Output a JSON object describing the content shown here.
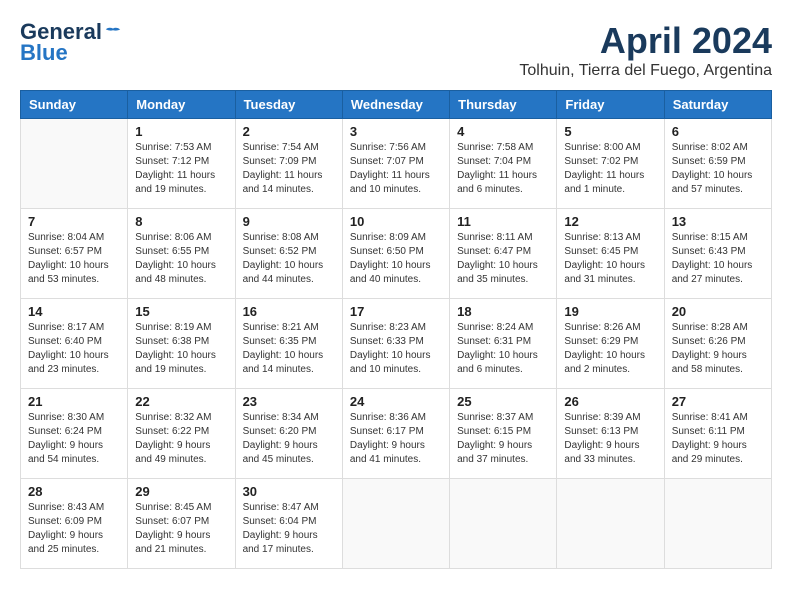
{
  "header": {
    "logo_line1": "General",
    "logo_line2": "Blue",
    "month": "April 2024",
    "location": "Tolhuin, Tierra del Fuego, Argentina"
  },
  "weekdays": [
    "Sunday",
    "Monday",
    "Tuesday",
    "Wednesday",
    "Thursday",
    "Friday",
    "Saturday"
  ],
  "weeks": [
    [
      {
        "day": "",
        "info": ""
      },
      {
        "day": "1",
        "info": "Sunrise: 7:53 AM\nSunset: 7:12 PM\nDaylight: 11 hours\nand 19 minutes."
      },
      {
        "day": "2",
        "info": "Sunrise: 7:54 AM\nSunset: 7:09 PM\nDaylight: 11 hours\nand 14 minutes."
      },
      {
        "day": "3",
        "info": "Sunrise: 7:56 AM\nSunset: 7:07 PM\nDaylight: 11 hours\nand 10 minutes."
      },
      {
        "day": "4",
        "info": "Sunrise: 7:58 AM\nSunset: 7:04 PM\nDaylight: 11 hours\nand 6 minutes."
      },
      {
        "day": "5",
        "info": "Sunrise: 8:00 AM\nSunset: 7:02 PM\nDaylight: 11 hours\nand 1 minute."
      },
      {
        "day": "6",
        "info": "Sunrise: 8:02 AM\nSunset: 6:59 PM\nDaylight: 10 hours\nand 57 minutes."
      }
    ],
    [
      {
        "day": "7",
        "info": "Sunrise: 8:04 AM\nSunset: 6:57 PM\nDaylight: 10 hours\nand 53 minutes."
      },
      {
        "day": "8",
        "info": "Sunrise: 8:06 AM\nSunset: 6:55 PM\nDaylight: 10 hours\nand 48 minutes."
      },
      {
        "day": "9",
        "info": "Sunrise: 8:08 AM\nSunset: 6:52 PM\nDaylight: 10 hours\nand 44 minutes."
      },
      {
        "day": "10",
        "info": "Sunrise: 8:09 AM\nSunset: 6:50 PM\nDaylight: 10 hours\nand 40 minutes."
      },
      {
        "day": "11",
        "info": "Sunrise: 8:11 AM\nSunset: 6:47 PM\nDaylight: 10 hours\nand 35 minutes."
      },
      {
        "day": "12",
        "info": "Sunrise: 8:13 AM\nSunset: 6:45 PM\nDaylight: 10 hours\nand 31 minutes."
      },
      {
        "day": "13",
        "info": "Sunrise: 8:15 AM\nSunset: 6:43 PM\nDaylight: 10 hours\nand 27 minutes."
      }
    ],
    [
      {
        "day": "14",
        "info": "Sunrise: 8:17 AM\nSunset: 6:40 PM\nDaylight: 10 hours\nand 23 minutes."
      },
      {
        "day": "15",
        "info": "Sunrise: 8:19 AM\nSunset: 6:38 PM\nDaylight: 10 hours\nand 19 minutes."
      },
      {
        "day": "16",
        "info": "Sunrise: 8:21 AM\nSunset: 6:35 PM\nDaylight: 10 hours\nand 14 minutes."
      },
      {
        "day": "17",
        "info": "Sunrise: 8:23 AM\nSunset: 6:33 PM\nDaylight: 10 hours\nand 10 minutes."
      },
      {
        "day": "18",
        "info": "Sunrise: 8:24 AM\nSunset: 6:31 PM\nDaylight: 10 hours\nand 6 minutes."
      },
      {
        "day": "19",
        "info": "Sunrise: 8:26 AM\nSunset: 6:29 PM\nDaylight: 10 hours\nand 2 minutes."
      },
      {
        "day": "20",
        "info": "Sunrise: 8:28 AM\nSunset: 6:26 PM\nDaylight: 9 hours\nand 58 minutes."
      }
    ],
    [
      {
        "day": "21",
        "info": "Sunrise: 8:30 AM\nSunset: 6:24 PM\nDaylight: 9 hours\nand 54 minutes."
      },
      {
        "day": "22",
        "info": "Sunrise: 8:32 AM\nSunset: 6:22 PM\nDaylight: 9 hours\nand 49 minutes."
      },
      {
        "day": "23",
        "info": "Sunrise: 8:34 AM\nSunset: 6:20 PM\nDaylight: 9 hours\nand 45 minutes."
      },
      {
        "day": "24",
        "info": "Sunrise: 8:36 AM\nSunset: 6:17 PM\nDaylight: 9 hours\nand 41 minutes."
      },
      {
        "day": "25",
        "info": "Sunrise: 8:37 AM\nSunset: 6:15 PM\nDaylight: 9 hours\nand 37 minutes."
      },
      {
        "day": "26",
        "info": "Sunrise: 8:39 AM\nSunset: 6:13 PM\nDaylight: 9 hours\nand 33 minutes."
      },
      {
        "day": "27",
        "info": "Sunrise: 8:41 AM\nSunset: 6:11 PM\nDaylight: 9 hours\nand 29 minutes."
      }
    ],
    [
      {
        "day": "28",
        "info": "Sunrise: 8:43 AM\nSunset: 6:09 PM\nDaylight: 9 hours\nand 25 minutes."
      },
      {
        "day": "29",
        "info": "Sunrise: 8:45 AM\nSunset: 6:07 PM\nDaylight: 9 hours\nand 21 minutes."
      },
      {
        "day": "30",
        "info": "Sunrise: 8:47 AM\nSunset: 6:04 PM\nDaylight: 9 hours\nand 17 minutes."
      },
      {
        "day": "",
        "info": ""
      },
      {
        "day": "",
        "info": ""
      },
      {
        "day": "",
        "info": ""
      },
      {
        "day": "",
        "info": ""
      }
    ]
  ]
}
